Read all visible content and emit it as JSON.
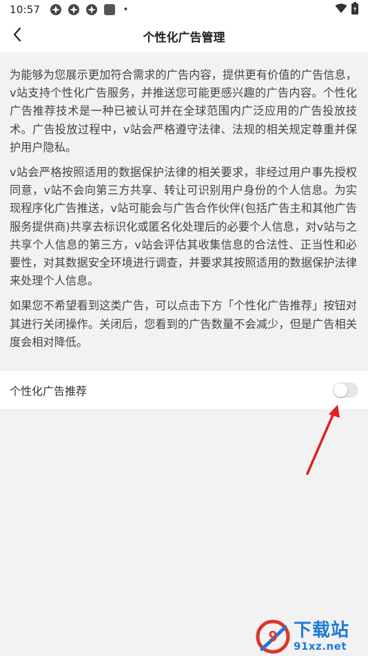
{
  "status_bar": {
    "time": "10:57",
    "dot": "•",
    "icons": [
      "notification-icon",
      "notification-icon",
      "notification-icon",
      "app-square-icon"
    ],
    "right_icons": [
      "wifi-icon",
      "battery-icon"
    ]
  },
  "header": {
    "back_icon": "chevron-left-icon",
    "title": "个性化广告管理"
  },
  "description": {
    "paragraphs": [
      "为能够为您展示更加符合需求的广告内容，提供更有价值的广告信息，v站支持个性化广告服务，并推送您可能更感兴趣的广告内容。个性化广告推荐技术是一种已被认可并在全球范围内广泛应用的广告投放技术。广告投放过程中，v站会严格遵守法律、法规的相关规定尊重并保护用户隐私。",
      "v站会严格按照适用的数据保护法律的相关要求，非经过用户事先授权同意，v站不会向第三方共享、转让可识别用户身份的个人信息。为实现程序化广告推送，v站可能会与广告合作伙伴(包括广告主和其他广告服务提供商)共享去标识化或匿名化处理后的必要个人信息，对v站与之共享个人信息的第三方，v站会评估其收集信息的合法性、正当性和必要性，对其数据安全环境进行调查，并要求其按照适用的数据保护法律来处理个人信息。",
      "如果您不希望看到这类广告，可以点击下方「个性化广告推荐」按钮对其进行关闭操作。关闭后，您看到的广告数量不会减少，但是广告相关度会相对降低。"
    ]
  },
  "setting": {
    "label": "个性化广告推荐",
    "toggle_on": false
  },
  "annotation": {
    "arrow_color": "#e02020"
  },
  "watermark": {
    "logo_text": "9",
    "cn_text": "下载站",
    "url_text": "91xz.net",
    "color": "#1e7ad6",
    "logo_color": "#e0322f"
  }
}
